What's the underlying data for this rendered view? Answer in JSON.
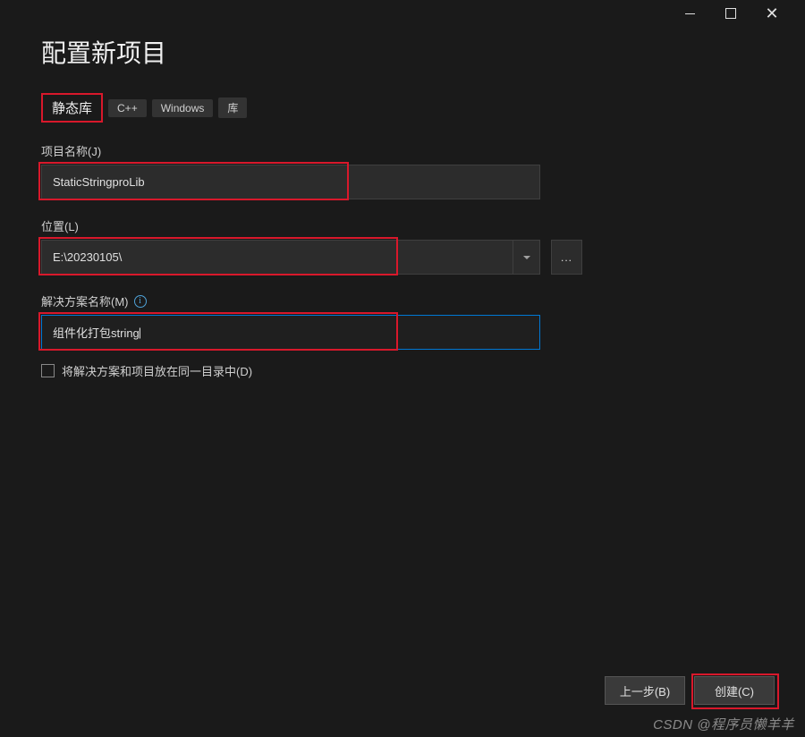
{
  "header": {
    "title": "配置新项目"
  },
  "template": {
    "name": "静态库",
    "tags": [
      "C++",
      "Windows",
      "库"
    ]
  },
  "fields": {
    "project_name": {
      "label": "项目名称(J)",
      "value": "StaticStringproLib"
    },
    "location": {
      "label": "位置(L)",
      "value": "E:\\20230105\\",
      "browse": "..."
    },
    "solution_name": {
      "label": "解决方案名称(M)",
      "value": "组件化打包string"
    },
    "same_directory": {
      "label": "将解决方案和项目放在同一目录中(D)",
      "checked": false
    }
  },
  "footer": {
    "back": "上一步(B)",
    "create": "创建(C)"
  },
  "watermark": "CSDN @程序员懒羊羊"
}
